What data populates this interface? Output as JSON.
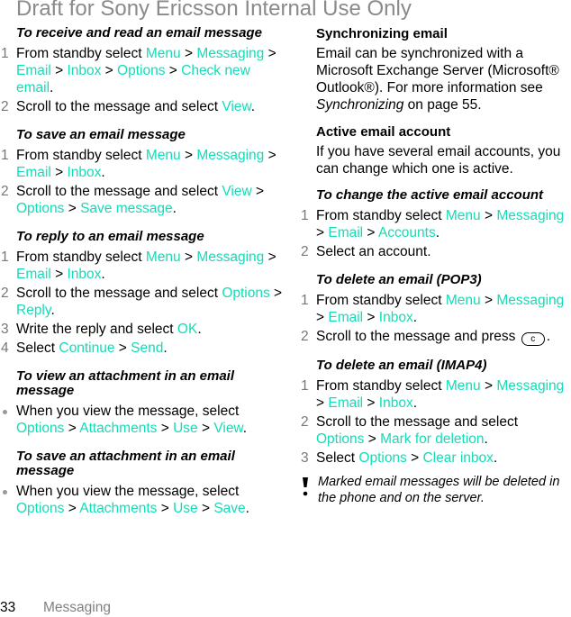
{
  "watermark": "Draft for Sony Ericsson Internal Use Only",
  "colors": {
    "link": "#13dcb6",
    "step_number": "#777777",
    "watermark": "#8a8a8a"
  },
  "left_column": {
    "receive": {
      "title": "To receive and read an email message",
      "steps": [
        {
          "num": "1",
          "parts": [
            "From standby select ",
            {
              "link": "Menu"
            },
            " > ",
            {
              "link": "Messaging"
            },
            " > ",
            {
              "link": "Email"
            },
            " > ",
            {
              "link": "Inbox"
            },
            " > ",
            {
              "link": "Options"
            },
            " > ",
            {
              "link": "Check new email"
            },
            "."
          ]
        },
        {
          "num": "2",
          "parts": [
            "Scroll to the message and select ",
            {
              "link": "View"
            },
            "."
          ]
        }
      ]
    },
    "save": {
      "title": "To save an email message",
      "steps": [
        {
          "num": "1",
          "parts": [
            "From standby select ",
            {
              "link": "Menu"
            },
            " > ",
            {
              "link": "Messaging"
            },
            " > ",
            {
              "link": "Email"
            },
            " > ",
            {
              "link": "Inbox"
            },
            "."
          ]
        },
        {
          "num": "2",
          "parts": [
            "Scroll to the message and select ",
            {
              "link": "View"
            },
            " > ",
            {
              "link": "Options"
            },
            " > ",
            {
              "link": "Save message"
            },
            "."
          ]
        }
      ]
    },
    "reply": {
      "title": "To reply to an email message",
      "steps": [
        {
          "num": "1",
          "parts": [
            "From standby select ",
            {
              "link": "Menu"
            },
            " > ",
            {
              "link": "Messaging"
            },
            " > ",
            {
              "link": "Email"
            },
            " > ",
            {
              "link": "Inbox"
            },
            "."
          ]
        },
        {
          "num": "2",
          "parts": [
            "Scroll to the message and select ",
            {
              "link": "Options"
            },
            " > ",
            {
              "link": "Reply"
            },
            "."
          ]
        },
        {
          "num": "3",
          "parts": [
            "Write the reply and select ",
            {
              "link": "OK"
            },
            "."
          ]
        },
        {
          "num": "4",
          "parts": [
            "Select ",
            {
              "link": "Continue"
            },
            " > ",
            {
              "link": "Send"
            },
            "."
          ]
        }
      ]
    },
    "view_attachment": {
      "title": "To view an attachment in an email message",
      "bullets": [
        {
          "parts": [
            "When you view the message, select ",
            {
              "link": "Options"
            },
            " > ",
            {
              "link": "Attachments"
            },
            " > ",
            {
              "link": "Use"
            },
            " > ",
            {
              "link": "View"
            },
            "."
          ]
        }
      ]
    },
    "save_attachment": {
      "title": "To save an attachment in an email message",
      "bullets": [
        {
          "parts": [
            "When you view the message, select ",
            {
              "link": "Options"
            },
            " > ",
            {
              "link": "Attachments"
            },
            " > ",
            {
              "link": "Use"
            },
            " > ",
            {
              "link": "Save"
            },
            "."
          ]
        }
      ]
    }
  },
  "right_column": {
    "sync": {
      "heading": "Synchronizing email",
      "text_before": "Email can be synchronized with a Microsoft Exchange Server (Microsoft® Outlook®). For more information see ",
      "ref": "Synchronizing",
      "text_after": " on page 55."
    },
    "active": {
      "heading": "Active email account",
      "text": "If you have several email accounts, you can change which one is active."
    },
    "change_active": {
      "title": "To change the active email account",
      "steps": [
        {
          "num": "1",
          "parts": [
            "From standby select ",
            {
              "link": "Menu"
            },
            " > ",
            {
              "link": "Messaging"
            },
            " > ",
            {
              "link": "Email"
            },
            " > ",
            {
              "link": "Accounts"
            },
            "."
          ]
        },
        {
          "num": "2",
          "parts": [
            "Select an account."
          ]
        }
      ]
    },
    "delete_pop3": {
      "title": "To delete an email (POP3)",
      "steps": [
        {
          "num": "1",
          "parts": [
            "From standby select ",
            {
              "link": "Menu"
            },
            " > ",
            {
              "link": "Messaging"
            },
            " > ",
            {
              "link": "Email"
            },
            " > ",
            {
              "link": "Inbox"
            },
            "."
          ]
        },
        {
          "num": "2",
          "parts": [
            "Scroll to the message and press ",
            {
              "key": "c"
            },
            "."
          ]
        }
      ]
    },
    "delete_imap4": {
      "title": "To delete an email (IMAP4)",
      "steps": [
        {
          "num": "1",
          "parts": [
            "From standby select ",
            {
              "link": "Menu"
            },
            " > ",
            {
              "link": "Messaging"
            },
            " > ",
            {
              "link": "Email"
            },
            " > ",
            {
              "link": "Inbox"
            },
            "."
          ]
        },
        {
          "num": "2",
          "parts": [
            "Scroll to the message and select ",
            {
              "link": "Options"
            },
            " > ",
            {
              "link": "Mark for deletion"
            },
            "."
          ]
        },
        {
          "num": "3",
          "parts": [
            "Select ",
            {
              "link": "Options"
            },
            " > ",
            {
              "link": "Clear inbox"
            },
            "."
          ]
        }
      ]
    },
    "note": {
      "icon": "exclamation-icon",
      "text": "Marked email messages will be deleted in the phone and on the server."
    }
  },
  "footer": {
    "page_number": "33",
    "section": "Messaging"
  }
}
